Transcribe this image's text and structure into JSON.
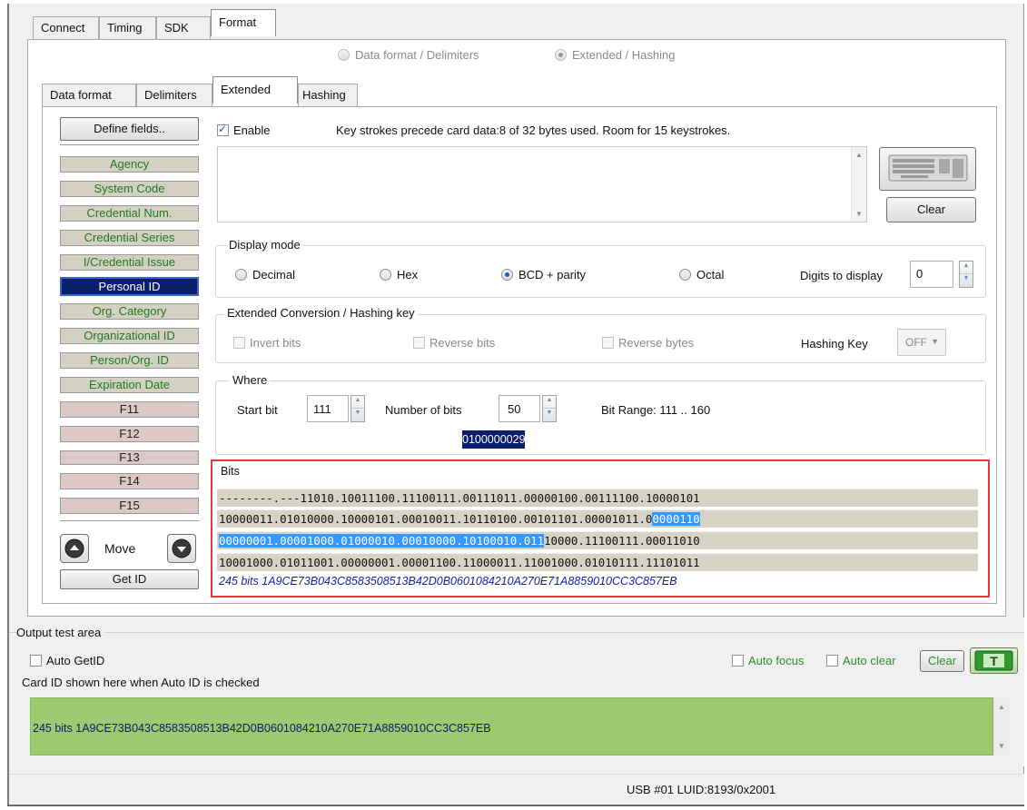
{
  "top_tabs": [
    "Connect",
    "Timing",
    "SDK",
    "Format"
  ],
  "format_mode": {
    "option1": "Data format / Delimiters",
    "option2": "Extended / Hashing",
    "selected": "Extended / Hashing"
  },
  "sub_tabs": [
    "Data format",
    "Delimiters",
    "Extended",
    "Hashing"
  ],
  "sidebar": {
    "define_label": "Define fields..",
    "fields": [
      "Agency",
      "System Code",
      "Credential Num.",
      "Credential Series",
      "I/Credential Issue",
      "Personal ID",
      "Org. Category",
      "Organizational ID",
      "Person/Org. ID",
      "Expiration Date",
      "F11",
      "F12",
      "F13",
      "F14",
      "F15"
    ],
    "selected_field": "Personal ID",
    "move_label": "Move",
    "up_icon": "up-arrow-icon",
    "down_icon": "down-arrow-icon",
    "get_id_label": "Get ID"
  },
  "keystrokes": {
    "enable_label": "Enable",
    "enabled": true,
    "info": "Key strokes precede card data:8 of 32 bytes used. Room for 15 keystrokes.",
    "keyboard_icon": "keyboard-icon",
    "clear_label": "Clear"
  },
  "display_mode": {
    "title": "Display mode",
    "options": [
      "Decimal",
      "Hex",
      "BCD + parity",
      "Octal"
    ],
    "selected": "BCD + parity",
    "digits_label": "Digits to display",
    "digits_value": "0"
  },
  "extended_conversion": {
    "title": "Extended Conversion / Hashing key",
    "invert_label": "Invert bits",
    "reverse_bits_label": "Reverse bits",
    "reverse_bytes_label": "Reverse bytes",
    "hashing_key_label": "Hashing Key",
    "hashing_key_value": "OFF"
  },
  "where": {
    "title": "Where",
    "start_bit_label": "Start bit",
    "start_bit_value": "111",
    "num_bits_label": "Number of bits",
    "num_bits_value": "50",
    "bit_range_label": "Bit Range: 111 .. 160",
    "value_display": "0100000029"
  },
  "bits": {
    "title": "Bits",
    "row1": "--------.---11010.10011100.11100111.00111011.00000100.00111100.10000101",
    "row2_a": "10000011.01010000.10000101.00010011.10110100.00101101.00001011.0",
    "row2_b": "0000110",
    "row3_a": "00000001.00001000.01000010.00010000.10100010.011",
    "row3_b": "10000.11100111.00011010",
    "row4": "10001000.01011001.00000001.00001100.11000011.11001000.01010111.11101011",
    "summary": "245 bits 1A9CE73B043C8583508513B42D0B0601084210A270E71A8859010CC3C857EB",
    "highlight_color": "#e03c3c"
  },
  "output": {
    "title": "Output test area",
    "auto_getid_label": "Auto GetID",
    "auto_focus_label": "Auto focus",
    "auto_clear_label": "Auto clear",
    "clear_label": "Clear",
    "test_icon": "test-t-icon",
    "hint": "Card ID shown here when Auto ID is checked",
    "value": "245 bits 1A9CE73B043C8583508513B42D0B0601084210A270E71A8859010CC3C857EB",
    "area_color": "#9acb6e"
  },
  "status": {
    "text": "USB #01 LUID:8193/0x2001"
  }
}
